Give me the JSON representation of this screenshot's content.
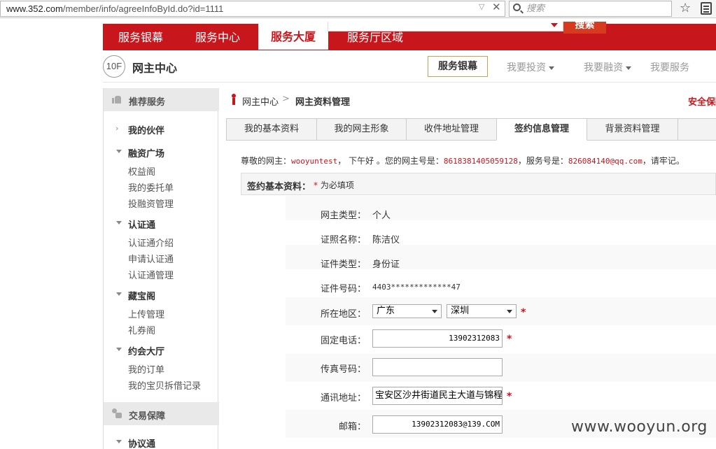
{
  "browser": {
    "url_host": "www.352.com",
    "url_path": "/member/info/agreeInfoById.do?id=1111",
    "search_placeholder": "搜索"
  },
  "topnav": {
    "items": [
      "服务银幕",
      "服务中心",
      "服务大厦",
      "服务厅区域"
    ],
    "active_index": 2,
    "search_button": "搜索"
  },
  "subheader": {
    "floor": "10F",
    "title": "网主中心",
    "nav": {
      "active": "服务银幕",
      "items": [
        "我要投资",
        "我要融资",
        "我要服务"
      ]
    }
  },
  "sidebar": {
    "section1": "推荐服务",
    "groups": [
      {
        "label": "我的伙伴",
        "expanded": false,
        "links": []
      },
      {
        "label": "融资广场",
        "expanded": true,
        "links": [
          "权益阁",
          "我的委托单",
          "投融资管理"
        ]
      },
      {
        "label": "认证通",
        "expanded": true,
        "links": [
          "认证通介绍",
          "申请认证通",
          "认证通管理"
        ]
      },
      {
        "label": "藏宝阁",
        "expanded": true,
        "links": [
          "上传管理",
          "礼券阁"
        ]
      },
      {
        "label": "约会大厅",
        "expanded": true,
        "links": [
          "我的订单",
          "我的宝贝拆借记录"
        ]
      }
    ],
    "section2": "交易保障",
    "group_after": {
      "label": "协议通"
    }
  },
  "breadcrumb": {
    "root": "网主中心",
    "separator": ">",
    "current": "网主资料管理",
    "right_text": "安全保障"
  },
  "tabs": [
    "我的基本资料",
    "我的网主形象",
    "收件地址管理",
    "签约信息管理",
    "背景资料管理"
  ],
  "active_tab": 3,
  "greeting": {
    "prefix": "尊敬的网主：",
    "username": "wooyuntest",
    "mid": "，  下午好  。您的网主号是：",
    "member_no": "8618381405059128",
    "service_label": "，服务号是：",
    "service_no": "826084140@qq.com",
    "suffix": "，请牢记。"
  },
  "basic_box": {
    "label": "签约基本资料：",
    "star": "*",
    "note": "为必填项"
  },
  "form": {
    "type_label": "网主类型：",
    "type_value": "个人",
    "cert_name_label": "证照名称：",
    "cert_name_value": "陈洁仪",
    "cert_type_label": "证件类型：",
    "cert_type_value": "身份证",
    "cert_no_label": "证件号码：",
    "cert_no_value": "4403*************47",
    "region_label": "所在地区：",
    "province": "广东",
    "city": "深圳",
    "phone_label": "固定电话：",
    "phone_value": "13902312083",
    "fax_label": "传真号码：",
    "fax_value": "",
    "address_label": "通讯地址：",
    "address_value": "宝安区沙井街道民主大道与锦程路",
    "email_label": "邮箱：",
    "email_value": "13902312083@139.COM",
    "required_mark": "*"
  },
  "watermark": "www.wooyun.org"
}
